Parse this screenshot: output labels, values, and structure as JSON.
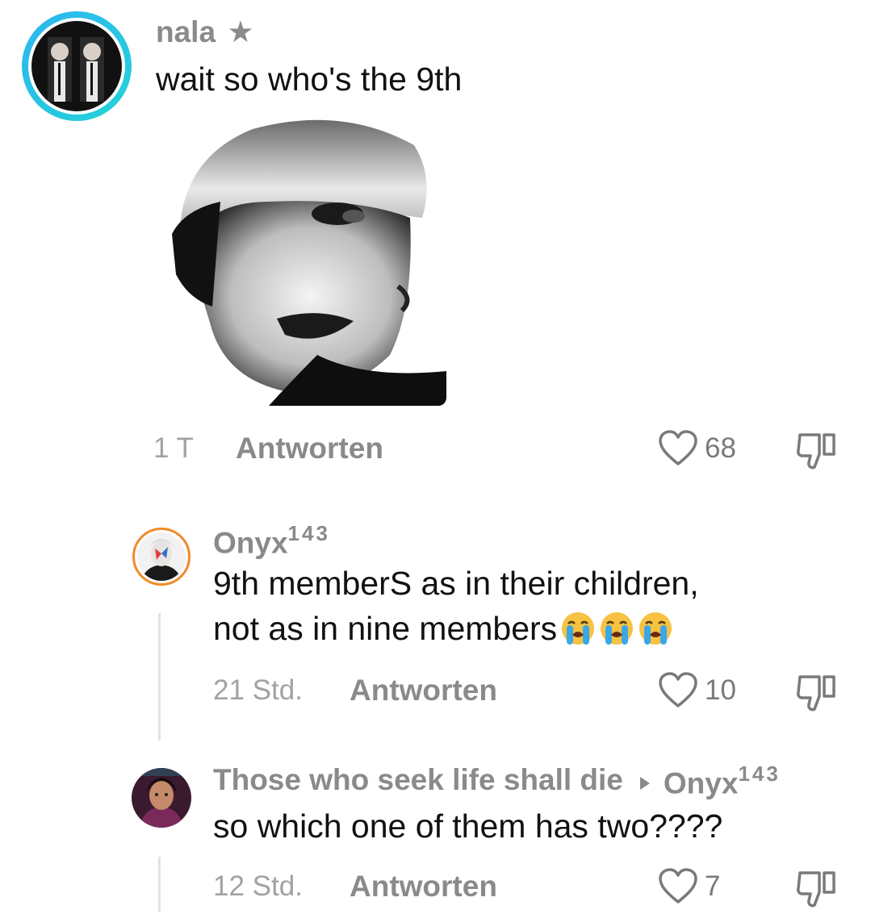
{
  "comments": [
    {
      "username": "nala",
      "badge": "★",
      "text": "wait so who's the 9th",
      "time": "1 T",
      "reply_label": "Antworten",
      "likes": "68"
    },
    {
      "username": "Onyx",
      "username_sup": "143",
      "text_line1": "9th memberS as in their children,",
      "text_line2": "not as in nine members",
      "emoji": [
        "crying-face",
        "crying-face",
        "crying-face"
      ],
      "time": "21 Std.",
      "reply_label": "Antworten",
      "likes": "10"
    },
    {
      "username": "Those who seek life shall die",
      "reply_to": "Onyx",
      "reply_to_sup": "143",
      "text": "so which one of them has two????",
      "time": "12 Std.",
      "reply_label": "Antworten",
      "likes": "7"
    }
  ],
  "icons": {
    "like": "heart-outline-icon",
    "dislike": "thumbs-down-icon",
    "reply_arrow": "caret-right-icon"
  },
  "colors": {
    "story_ring": "#22c6e8",
    "avatar2_ring": "#f08a2a",
    "meta_gray": "#a2a2a2",
    "username_gray": "#8a8a8a"
  }
}
